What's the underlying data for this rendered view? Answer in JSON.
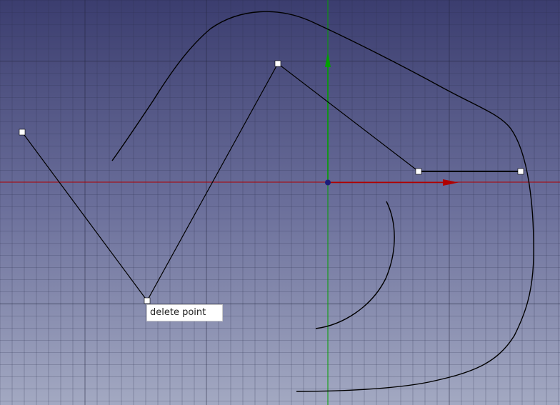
{
  "tooltip": {
    "text": "delete point"
  },
  "colors": {
    "background_top": "#3b3d6f",
    "background_bottom": "#a3a9c2",
    "grid_line": "#2e3050",
    "x_axis": "#b00000",
    "y_axis": "#00a000",
    "origin": "#1c1c7a",
    "geometry": "#000000",
    "control_point_fill": "#ffffff"
  },
  "icons": {
    "x_axis_arrow": "red-arrow-icon",
    "y_axis_arrow": "green-arrow-icon",
    "origin": "origin-point-icon"
  }
}
